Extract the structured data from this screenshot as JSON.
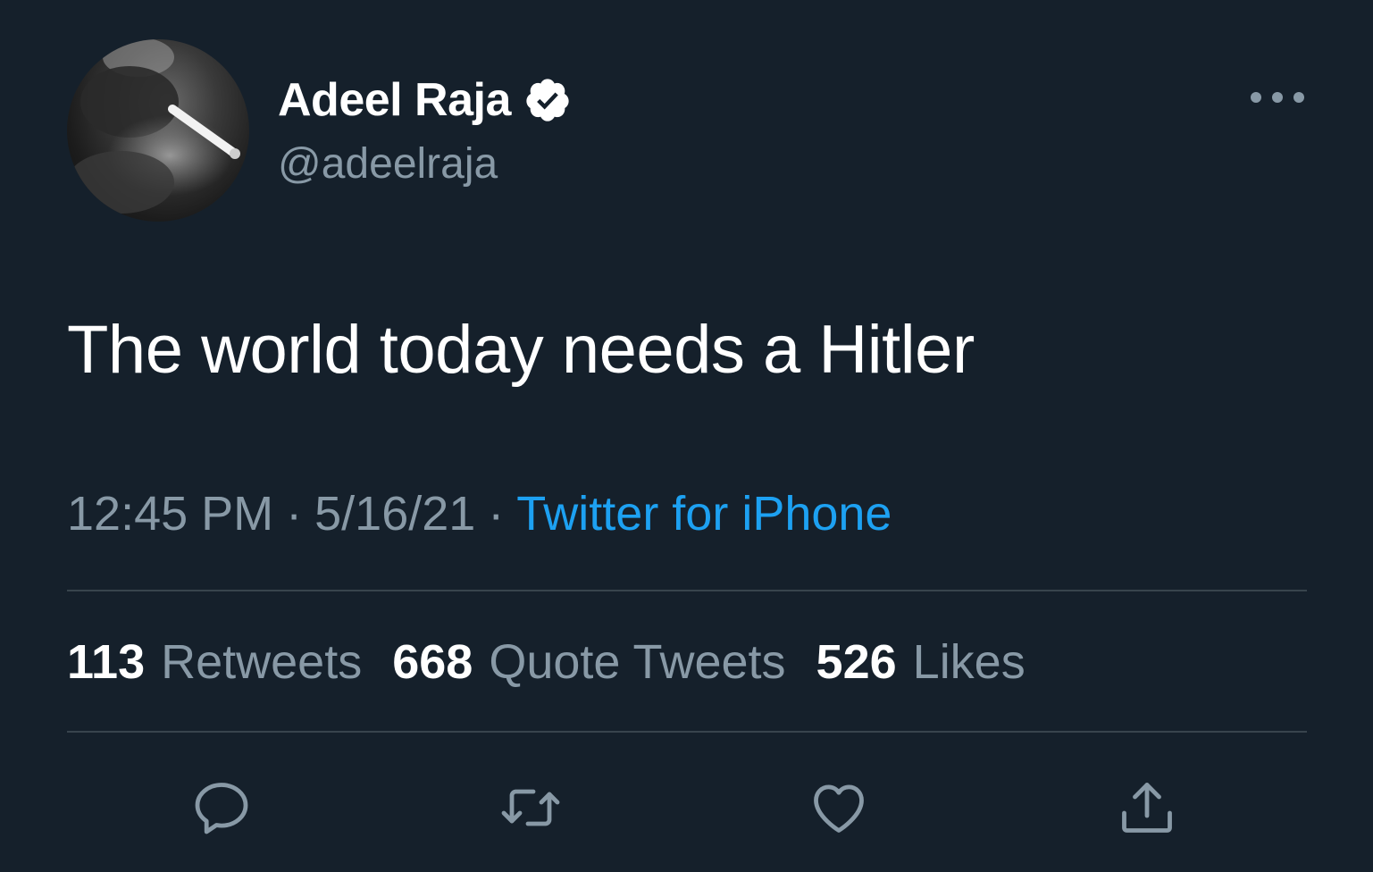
{
  "author": {
    "display_name": "Adeel Raja",
    "handle": "@adeelraja",
    "verified": true,
    "avatar_icon": "profile-photo"
  },
  "tweet": {
    "text": "The world today needs a Hitler",
    "time": "12:45 PM",
    "date": "5/16/21",
    "separator": "·",
    "source": "Twitter for iPhone"
  },
  "stats": {
    "retweets_count": "113",
    "retweets_label": "Retweets",
    "quotes_count": "668",
    "quotes_label": "Quote Tweets",
    "likes_count": "526",
    "likes_label": "Likes"
  },
  "actions": {
    "reply_icon": "reply-icon",
    "retweet_icon": "retweet-icon",
    "like_icon": "heart-icon",
    "share_icon": "share-icon"
  },
  "colors": {
    "background": "#15202b",
    "primary_text": "#ffffff",
    "secondary_text": "#8899a6",
    "accent": "#1da1f2",
    "divider": "#38444d"
  }
}
